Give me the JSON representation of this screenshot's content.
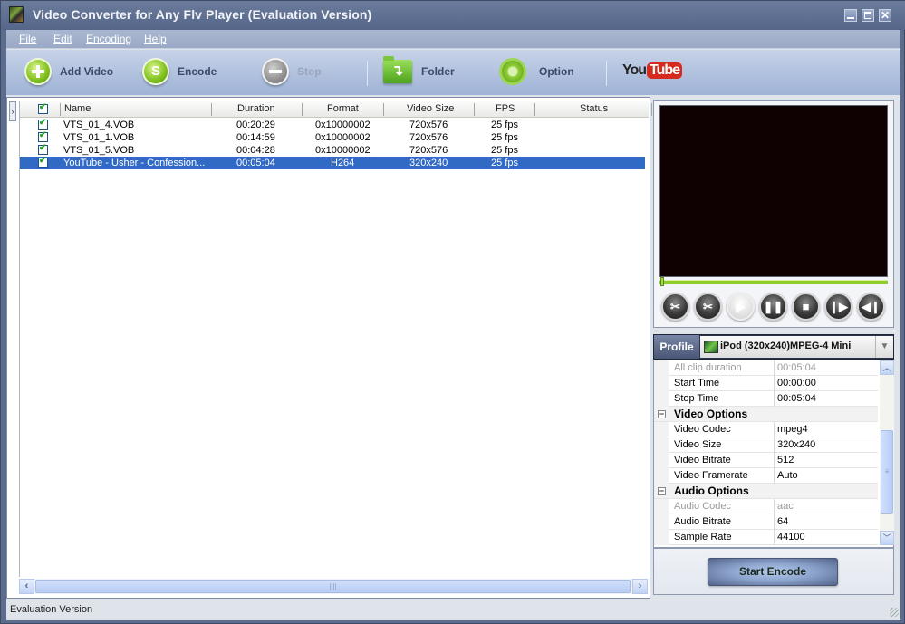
{
  "window": {
    "title": "Video Converter for Any Flv Player (Evaluation Version)",
    "controls": [
      "minimize",
      "maximize",
      "close"
    ]
  },
  "menu": [
    {
      "label": "File",
      "accel": "F"
    },
    {
      "label": "Edit",
      "accel": "E"
    },
    {
      "label": "Encoding",
      "accel": "E"
    },
    {
      "label": "Help",
      "accel": "H"
    }
  ],
  "toolbar": {
    "add_video": "Add Video",
    "encode": "Encode",
    "stop": "Stop",
    "folder": "Folder",
    "option": "Option",
    "youtube_you": "You",
    "youtube_tube": "Tube"
  },
  "file_list": {
    "columns": [
      "Name",
      "Duration",
      "Format",
      "Video Size",
      "FPS",
      "Status"
    ],
    "rows": [
      {
        "checked": true,
        "name": "VTS_01_4.VOB",
        "duration": "00:20:29",
        "format": "0x10000002",
        "video_size": "720x576",
        "fps": "25 fps",
        "status": "",
        "selected": false
      },
      {
        "checked": true,
        "name": "VTS_01_1.VOB",
        "duration": "00:14:59",
        "format": "0x10000002",
        "video_size": "720x576",
        "fps": "25 fps",
        "status": "",
        "selected": false
      },
      {
        "checked": true,
        "name": "VTS_01_5.VOB",
        "duration": "00:04:28",
        "format": "0x10000002",
        "video_size": "720x576",
        "fps": "25 fps",
        "status": "",
        "selected": false
      },
      {
        "checked": true,
        "name": "YouTube - Usher - Confession...",
        "duration": "00:05:04",
        "format": "H264",
        "video_size": "320x240",
        "fps": "25 fps",
        "status": "",
        "selected": true
      }
    ]
  },
  "player": {
    "position_fraction": 0.0,
    "buttons": [
      "cut-start",
      "cut-end",
      "play",
      "pause",
      "stop",
      "next-frame",
      "previous-frame"
    ]
  },
  "profile": {
    "label": "Profile",
    "selected": "iPod (320x240)MPEG-4 Mini"
  },
  "properties": [
    {
      "type": "item",
      "key": "All clip duration",
      "value": "00:05:04",
      "disabled": true
    },
    {
      "type": "item",
      "key": "Start Time",
      "value": "00:00:00",
      "disabled": false
    },
    {
      "type": "item",
      "key": "Stop Time",
      "value": "00:05:04",
      "disabled": false
    },
    {
      "type": "category",
      "key": "Video Options",
      "toggle": "−"
    },
    {
      "type": "item",
      "key": "Video Codec",
      "value": "mpeg4",
      "disabled": false
    },
    {
      "type": "item",
      "key": "Video Size",
      "value": "320x240",
      "disabled": false
    },
    {
      "type": "item",
      "key": "Video Bitrate",
      "value": "512",
      "disabled": false
    },
    {
      "type": "item",
      "key": "Video Framerate",
      "value": "Auto",
      "disabled": false
    },
    {
      "type": "category",
      "key": "Audio Options",
      "toggle": "−"
    },
    {
      "type": "item",
      "key": "Audio Codec",
      "value": "aac",
      "disabled": true
    },
    {
      "type": "item",
      "key": "Audio Bitrate",
      "value": "64",
      "disabled": false
    },
    {
      "type": "item",
      "key": "Sample Rate",
      "value": "44100",
      "disabled": false
    }
  ],
  "start_encode": "Start Encode",
  "status_bar": "Evaluation Version",
  "colors": {
    "selection": "#316ac5",
    "accent_green": "#7fbf1c",
    "youtube_red": "#d52b1e"
  }
}
